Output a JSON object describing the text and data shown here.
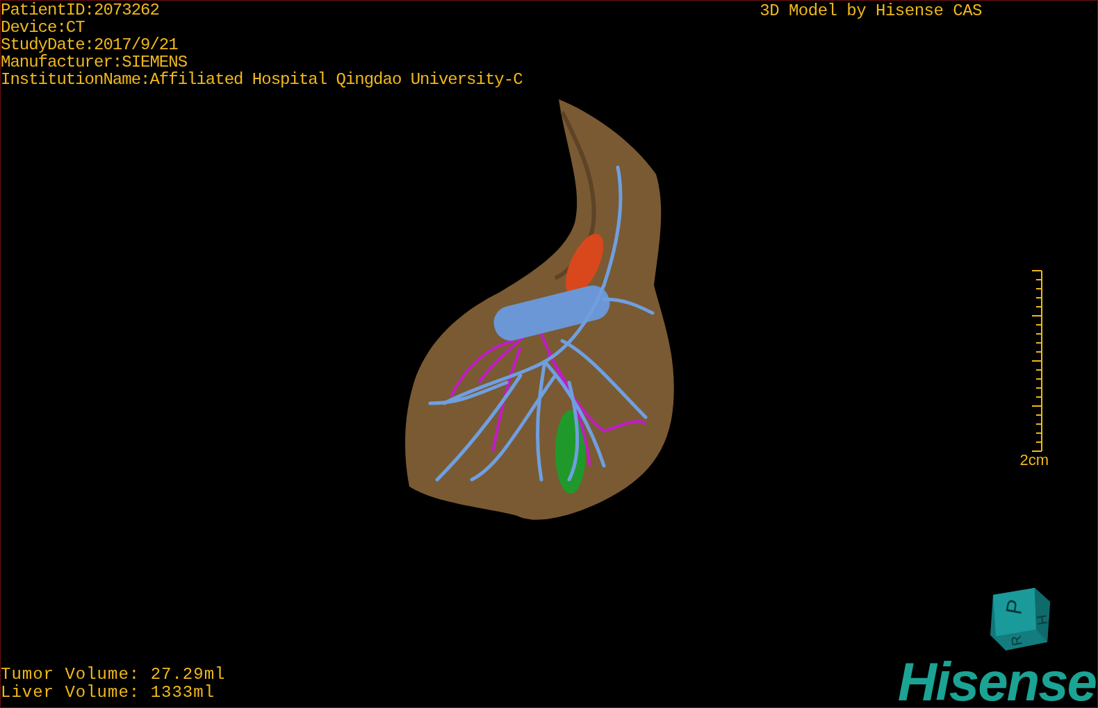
{
  "patient_info": [
    "PatientID:2073262",
    "Device:CT",
    "StudyDate:2017/9/21",
    "Manufacturer:SIEMENS",
    "InstitutionName:Affiliated Hospital Qingdao University-C"
  ],
  "title": "3D Model by Hisense CAS",
  "scale_bar": {
    "label": "2cm"
  },
  "volumes": [
    "Tumor Volume: 27.29ml",
    "Liver Volume: 1333ml"
  ],
  "orientation_cube": {
    "faces": [
      "P",
      "H",
      "R"
    ]
  },
  "logo": "Hisense"
}
